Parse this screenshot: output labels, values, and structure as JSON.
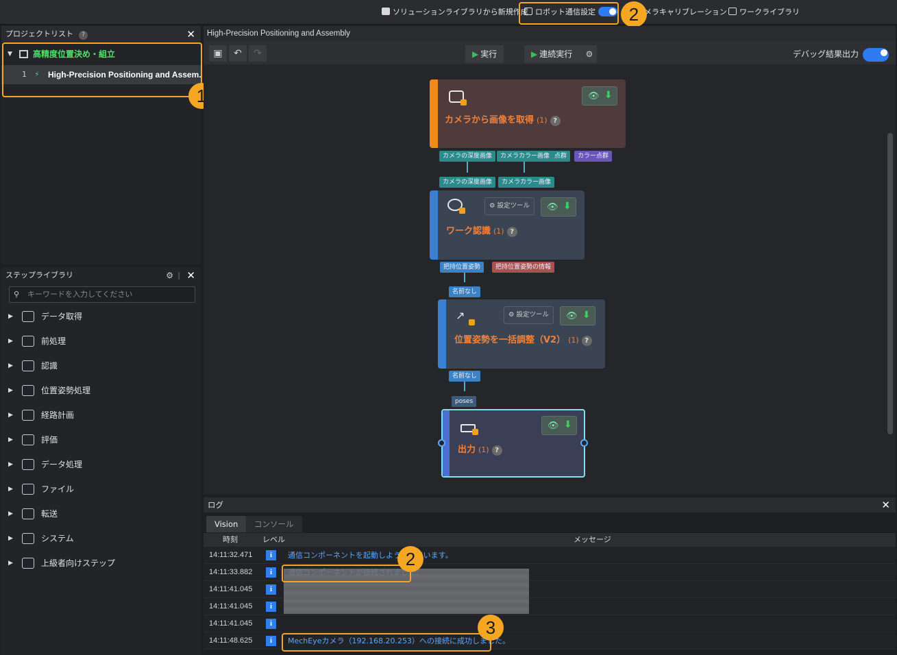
{
  "topbar": {
    "new_from_library": "ソリューションライブラリから新規作成",
    "robot_comm_settings": "ロボット通信設定",
    "camera_calibration": "メラキャリブレーション",
    "work_library": "ワークライブラリ"
  },
  "callouts": [
    "1",
    "2",
    "3"
  ],
  "project_list": {
    "title": "プロジェクトリスト",
    "help": "?",
    "project_name": "高精度位置決め・組立",
    "solution_index": "1",
    "solution_name": "High-Precision Positioning and Assem..."
  },
  "step_library": {
    "title": "ステップライブラリ",
    "search_placeholder": "キーワードを入力してください",
    "categories": [
      {
        "label": "データ取得",
        "icon": "camera-icon"
      },
      {
        "label": "前処理",
        "icon": "preprocess-icon"
      },
      {
        "label": "認識",
        "icon": "recognition-icon"
      },
      {
        "label": "位置姿勢処理",
        "icon": "pose-icon"
      },
      {
        "label": "経路計画",
        "icon": "path-icon"
      },
      {
        "label": "評価",
        "icon": "evaluate-icon"
      },
      {
        "label": "データ処理",
        "icon": "data-process-icon"
      },
      {
        "label": "ファイル",
        "icon": "file-icon"
      },
      {
        "label": "転送",
        "icon": "transfer-icon"
      },
      {
        "label": "システム",
        "icon": "system-icon"
      },
      {
        "label": "上級者向けステップ",
        "icon": "advanced-icon"
      }
    ]
  },
  "main": {
    "title": "High-Precision Positioning and Assembly",
    "run_label": "実行",
    "continuous_run_label": "連続実行",
    "debug_output_label": "デバッグ結果出力"
  },
  "nodes": {
    "capture": {
      "title": "カメラから画像を取得",
      "count": "(1)",
      "outputs": [
        "カメラの深度画像",
        "カメラカラー画像",
        "点群",
        "カラー点群"
      ]
    },
    "recognition": {
      "title": "ワーク認識",
      "count": "(1)",
      "settings_tool": "設定ツール",
      "inputs": [
        "カメラの深度画像",
        "カメラカラー画像"
      ],
      "outputs": [
        "把持位置姿勢",
        "把持位置姿勢の情報"
      ]
    },
    "adjust": {
      "title": "位置姿勢を一括調整（V2）",
      "count": "(1)",
      "settings_tool": "設定ツール",
      "input": "名前なし",
      "output": "名前なし"
    },
    "output": {
      "title": "出力",
      "count": "(1)",
      "input": "poses"
    }
  },
  "log": {
    "title": "ログ",
    "tabs": [
      "Vision",
      "コンソール"
    ],
    "columns": {
      "time": "時刻",
      "level": "レベル",
      "message": "メッセージ"
    },
    "rows": [
      {
        "time": "14:11:32.471",
        "level": "i",
        "message": "通信コンポーネントを起動しようとしています。"
      },
      {
        "time": "14:11:33.882",
        "level": "i",
        "message": "通信コンポーネントが接続されました。"
      },
      {
        "time": "14:11:41.045",
        "level": "i",
        "message": ""
      },
      {
        "time": "14:11:41.045",
        "level": "i",
        "message": ""
      },
      {
        "time": "14:11:41.045",
        "level": "i",
        "message": ""
      },
      {
        "time": "14:11:48.625",
        "level": "i",
        "message": "MechEyeカメラ（192.168.20.253）への接続に成功しました。"
      }
    ]
  },
  "colors": {
    "accent": "#f5a623",
    "toggle_on": "#2f7bf0",
    "node_title": "#f0813a",
    "log_text": "#5aa8ff"
  }
}
